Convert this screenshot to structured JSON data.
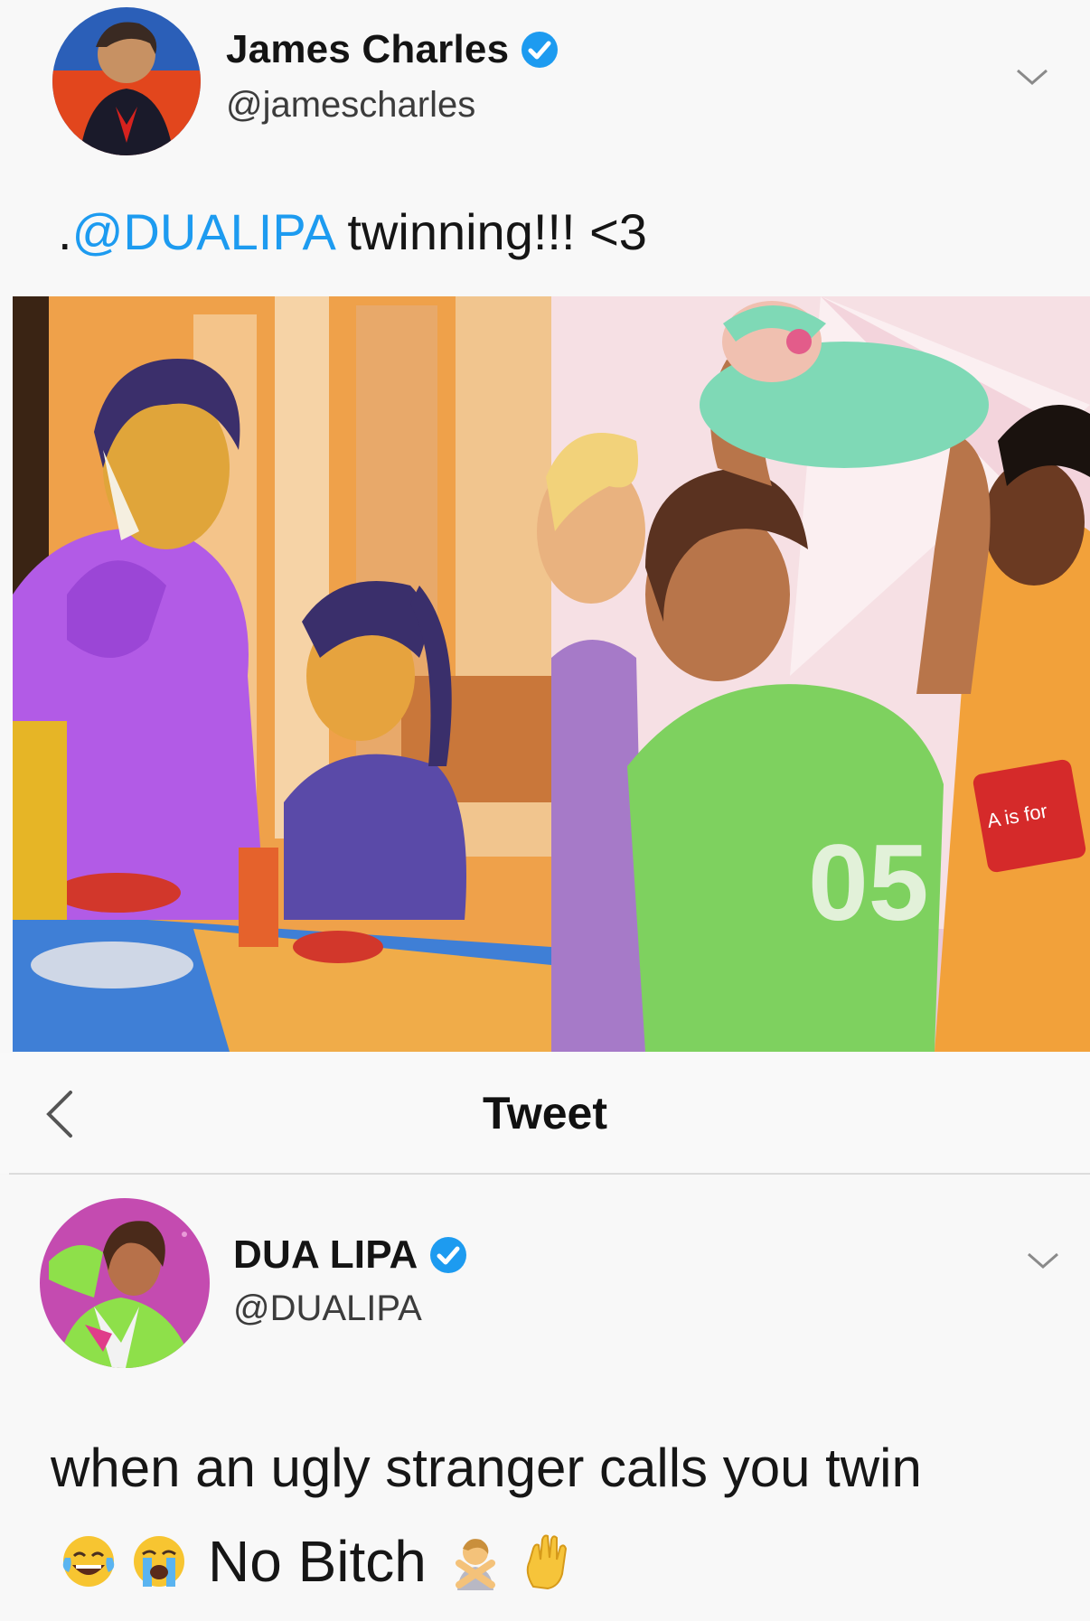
{
  "tweet": {
    "author_name": "James Charles",
    "author_handle": "@jamescharles",
    "verified": true,
    "text_prefix": ".",
    "mention": "@DUALIPA",
    "text_rest": " twinning!!! <3",
    "media_description_icons": [
      "comic-panel-left",
      "comic-panel-right"
    ]
  },
  "nav": {
    "back_icon": "chevron-left-icon",
    "title": "Tweet"
  },
  "reply": {
    "author_name": "DUA LIPA",
    "author_handle": "@DUALIPA",
    "verified": true,
    "text_line1": "when an ugly stranger calls you twin",
    "text_line2": "No Bitch",
    "emojis_before": [
      "face-with-tears-of-joy-icon",
      "loudly-crying-face-icon"
    ],
    "emojis_after": [
      "person-gesturing-no-icon",
      "raised-hand-icon"
    ]
  },
  "colors": {
    "mention": "#1d9bf0",
    "verified": "#1d9bf0",
    "background": "#f8f8f8"
  }
}
